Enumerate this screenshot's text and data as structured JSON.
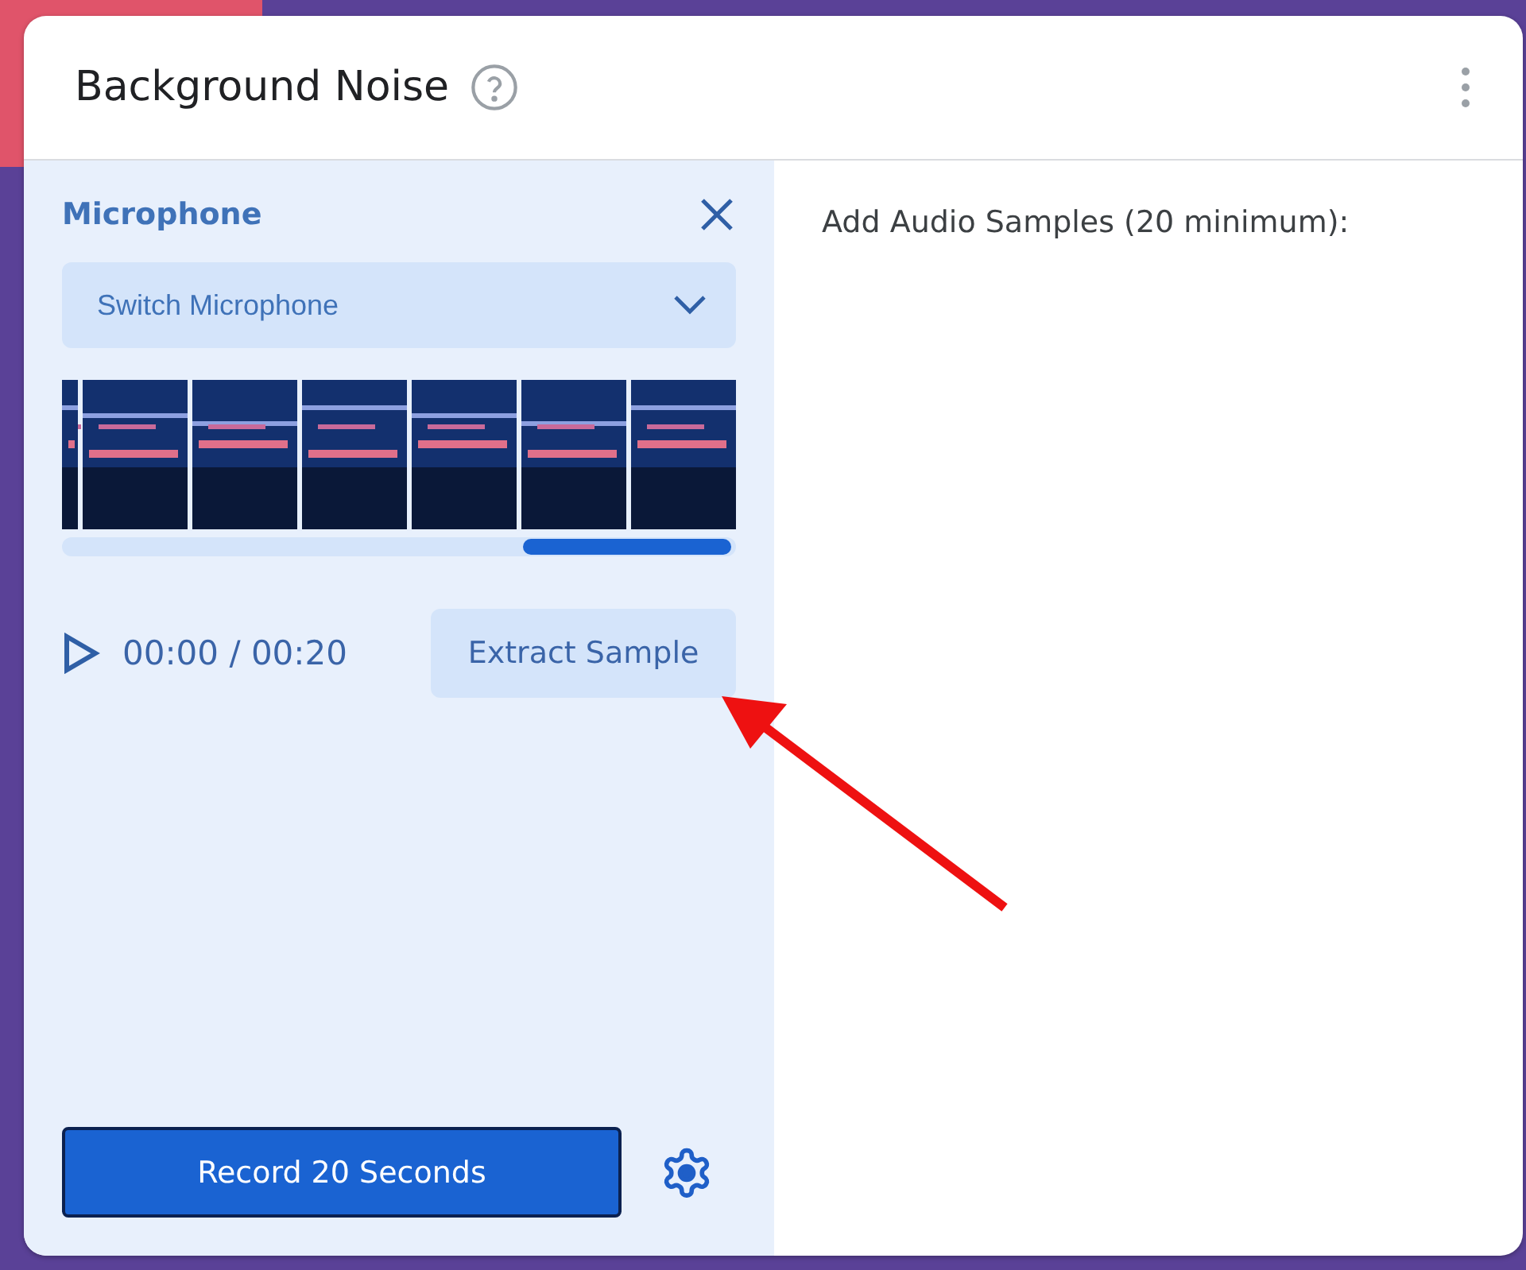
{
  "header": {
    "title": "Background Noise"
  },
  "recorder": {
    "title": "Microphone",
    "device_select": {
      "label": "Switch Microphone"
    },
    "time": "00:00 / 00:20",
    "extract_button": "Extract Sample",
    "record_button": "Record 20 Seconds"
  },
  "samples": {
    "heading": "Add Audio Samples (20 minimum):"
  }
}
